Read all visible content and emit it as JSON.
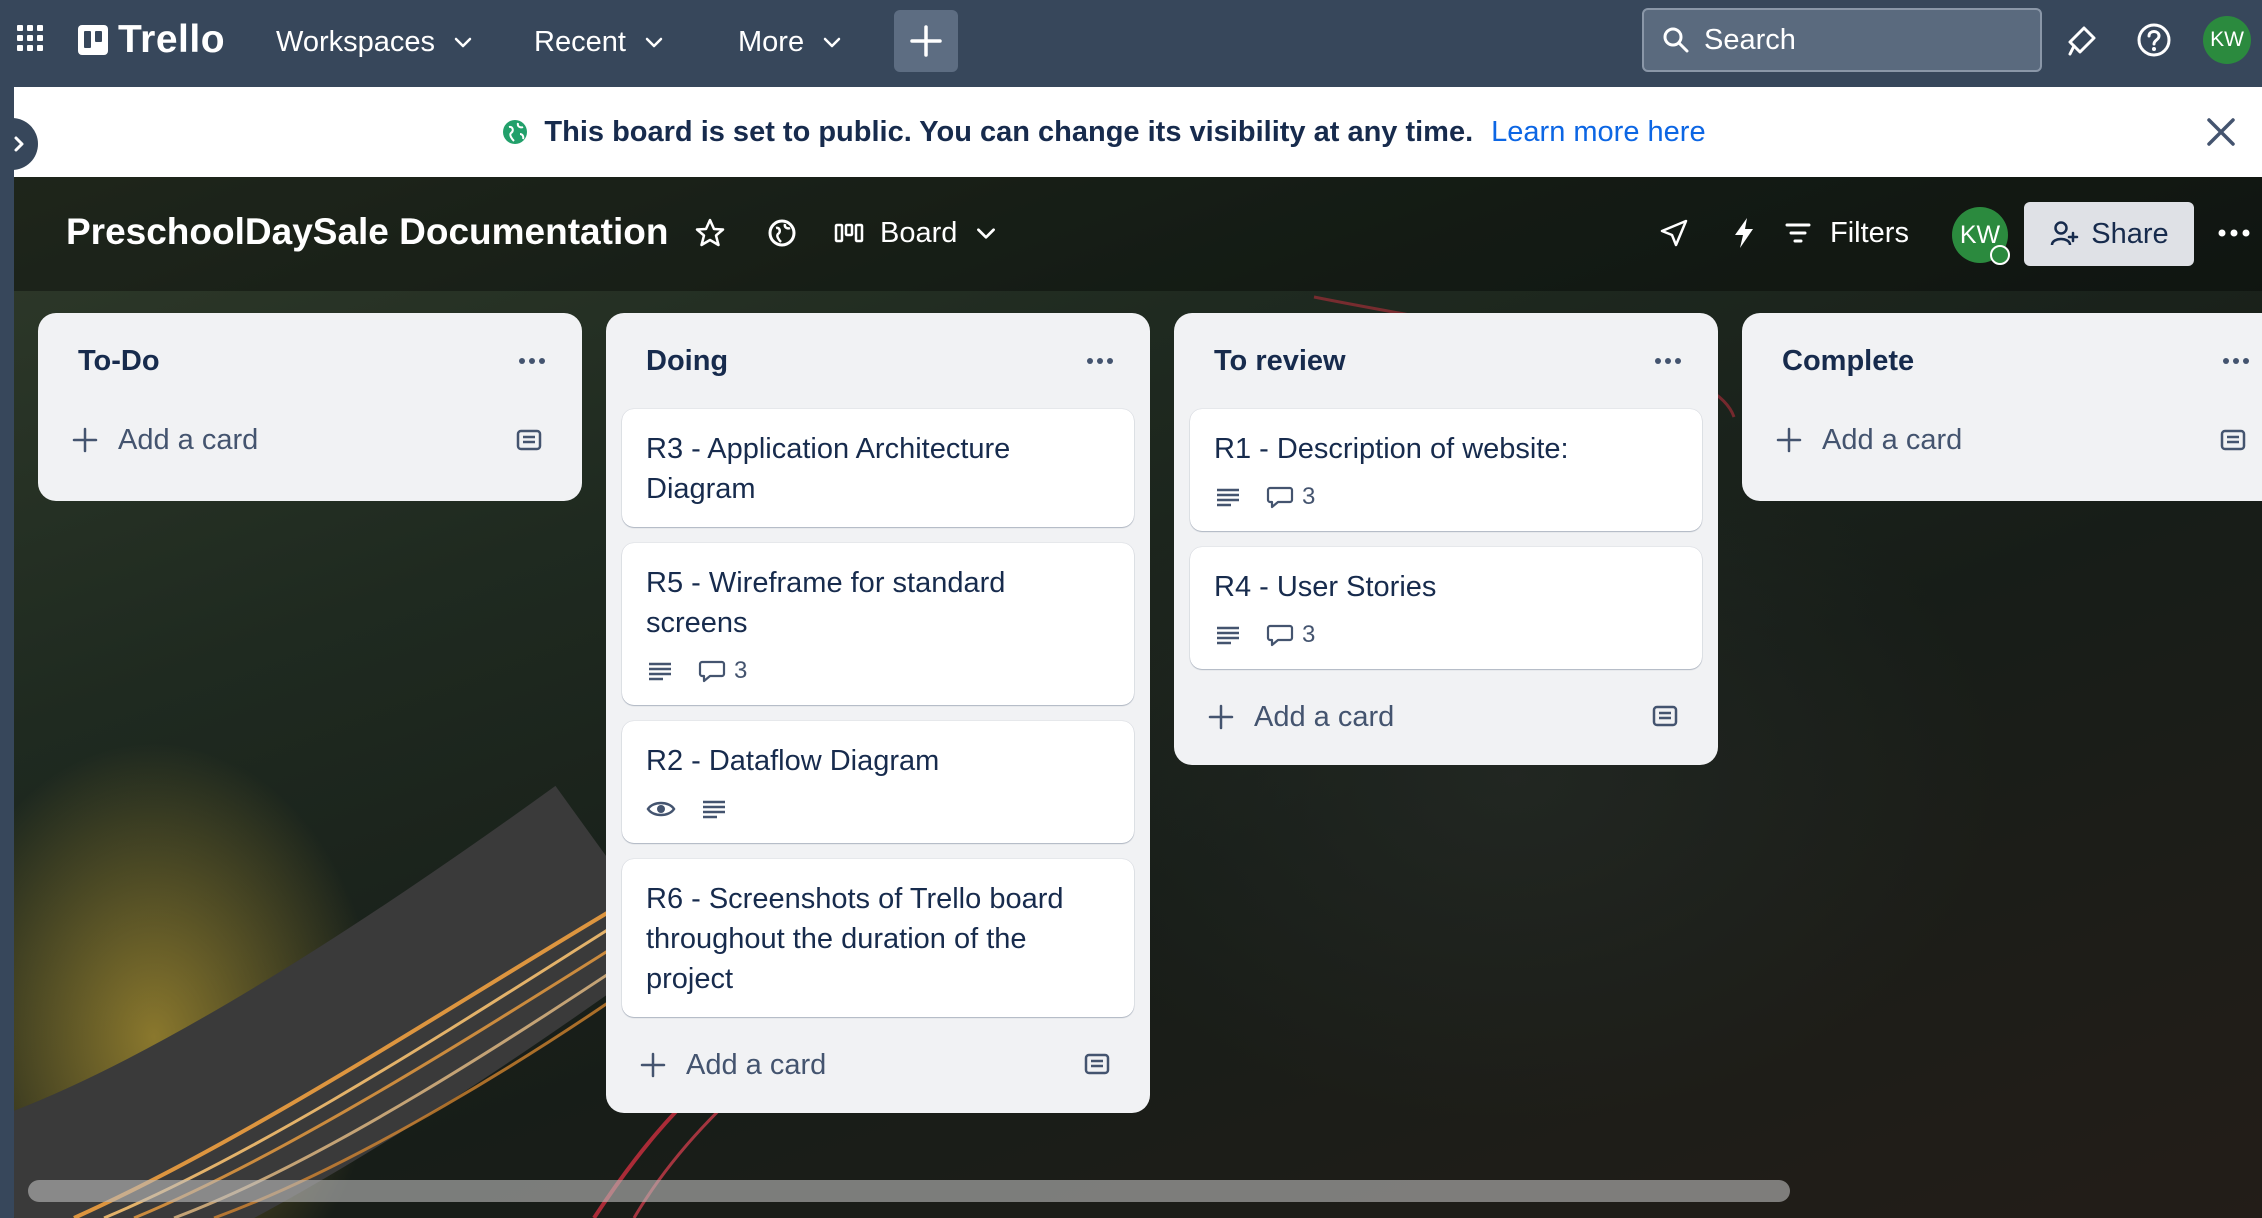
{
  "nav": {
    "logo_text": "Trello",
    "workspaces_label": "Workspaces",
    "recent_label": "Recent",
    "more_label": "More",
    "search_placeholder": "Search",
    "avatar_initials": "KW"
  },
  "banner": {
    "message": "This board is set to public. You can change its visibility at any time.",
    "link": "Learn more here"
  },
  "board": {
    "title": "PreschoolDaySale Documentation",
    "view_label": "Board",
    "filters_label": "Filters",
    "avatar_initials": "KW",
    "share_label": "Share"
  },
  "lists": [
    {
      "title": "To-Do",
      "add_label": "Add a card",
      "cards": []
    },
    {
      "title": "Doing",
      "add_label": "Add a card",
      "cards": [
        {
          "title": "R3 - Application Architecture Diagram"
        },
        {
          "title": "R5 - Wireframe for standard screens",
          "has_description": true,
          "comments": "3"
        },
        {
          "title": "R2 - Dataflow Diagram",
          "watching": true,
          "has_description": true
        },
        {
          "title": "R6 - Screenshots of Trello board throughout the duration of the project"
        }
      ]
    },
    {
      "title": "To review",
      "add_label": "Add a card",
      "cards": [
        {
          "title": "R1 - Description of website:",
          "has_description": true,
          "comments": "3"
        },
        {
          "title": "R4 - User Stories",
          "has_description": true,
          "comments": "3"
        }
      ]
    },
    {
      "title": "Complete",
      "add_label": "Add a card",
      "cards": []
    }
  ],
  "colors": {
    "nav_bg": "#37475b",
    "link_blue": "#0c66e4",
    "avatar_green": "#2b8a3e",
    "list_bg": "#f1f2f4"
  }
}
